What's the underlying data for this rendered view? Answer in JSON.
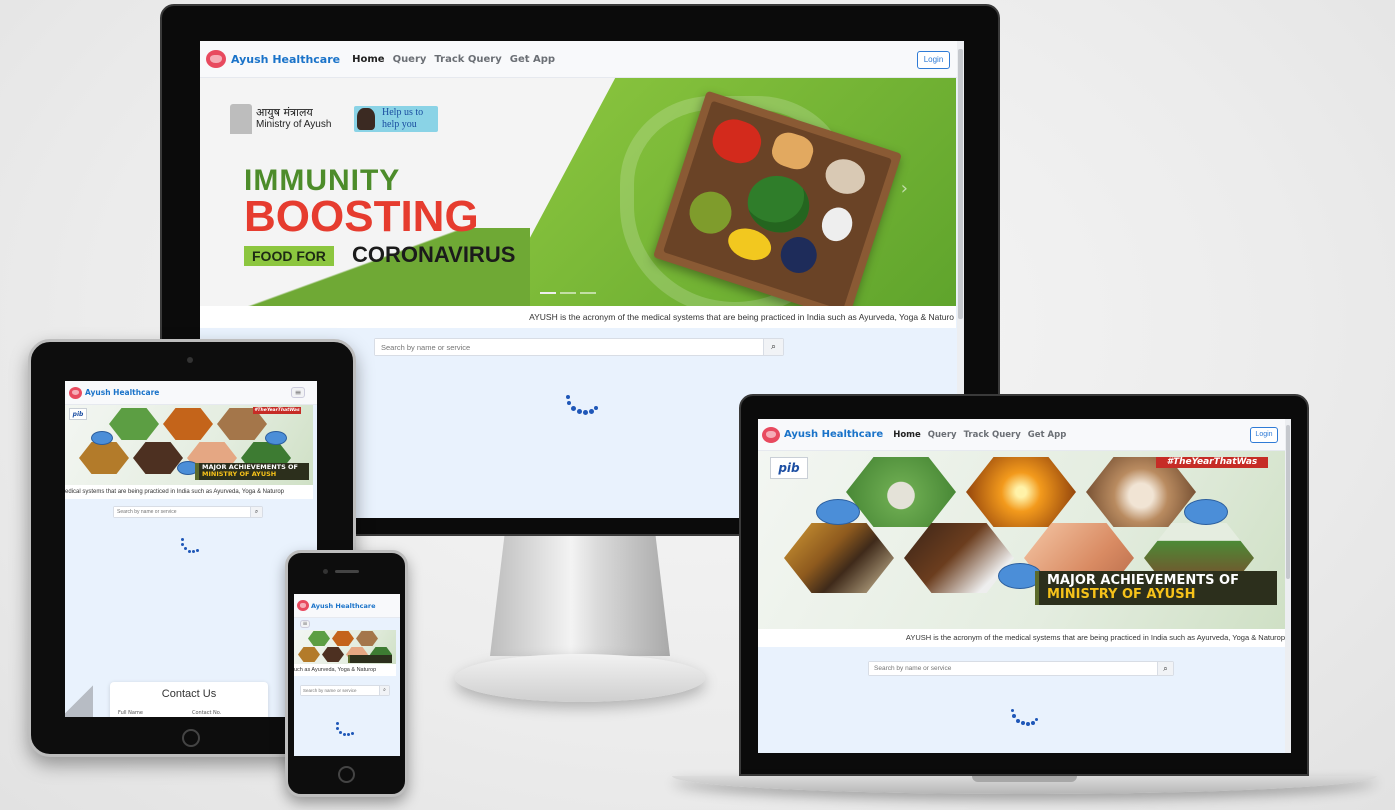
{
  "brand": {
    "name": "Ayush Healthcare"
  },
  "nav": {
    "items": [
      "Home",
      "Query",
      "Track Query",
      "Get App"
    ],
    "login_label": "Login"
  },
  "search": {
    "placeholder": "Search by name or service",
    "button_icon": "search-icon"
  },
  "marquee_text": "AYUSH is the acronym of the medical systems that are being practiced in India such as Ayurveda, Yoga & Naturopathy",
  "desktop_banner": {
    "ministry_hindi": "आयुष मंत्रालय",
    "ministry_english": "Ministry of Ayush",
    "help_badge_line1": "Help us to",
    "help_badge_line2": "help you",
    "headline_1": "IMMUNITY",
    "headline_2": "BOOSTING",
    "headline_3a": "FOOD FOR",
    "headline_3b": "CORONAVIRUS"
  },
  "achievements_banner": {
    "pib_label": "pib",
    "tag": "#TheYearThatWas",
    "line1": "MAJOR ACHIEVEMENTS OF",
    "line2": "MINISTRY OF AYUSH"
  },
  "tablet": {
    "marquee_visible": "edical systems that are being practiced in India such as Ayurveda, Yoga & Naturop",
    "contact_title": "Contact Us",
    "contact_field_1": "Full Name",
    "contact_field_2": "Contact No."
  },
  "phone": {
    "marquee_visible": "uch as Ayurveda, Yoga & Naturop"
  },
  "laptop": {
    "marquee_visible": "AYUSH is the acronym of the medical systems that are being practiced in India such as Ayurveda, Yoga & Naturop"
  },
  "desktop": {
    "marquee_visible": "AYUSH is the acronym of the medical systems that are being practiced in India such as Ayurveda, Yoga & Naturo"
  },
  "colors": {
    "brand_blue": "#1a73c9",
    "spinner_blue": "#1f57b8",
    "page_background": "#e9f2fd",
    "boosting_red": "#e63c2f",
    "immunity_green": "#4d8c2a",
    "achievement_gold": "#f6c21a"
  }
}
